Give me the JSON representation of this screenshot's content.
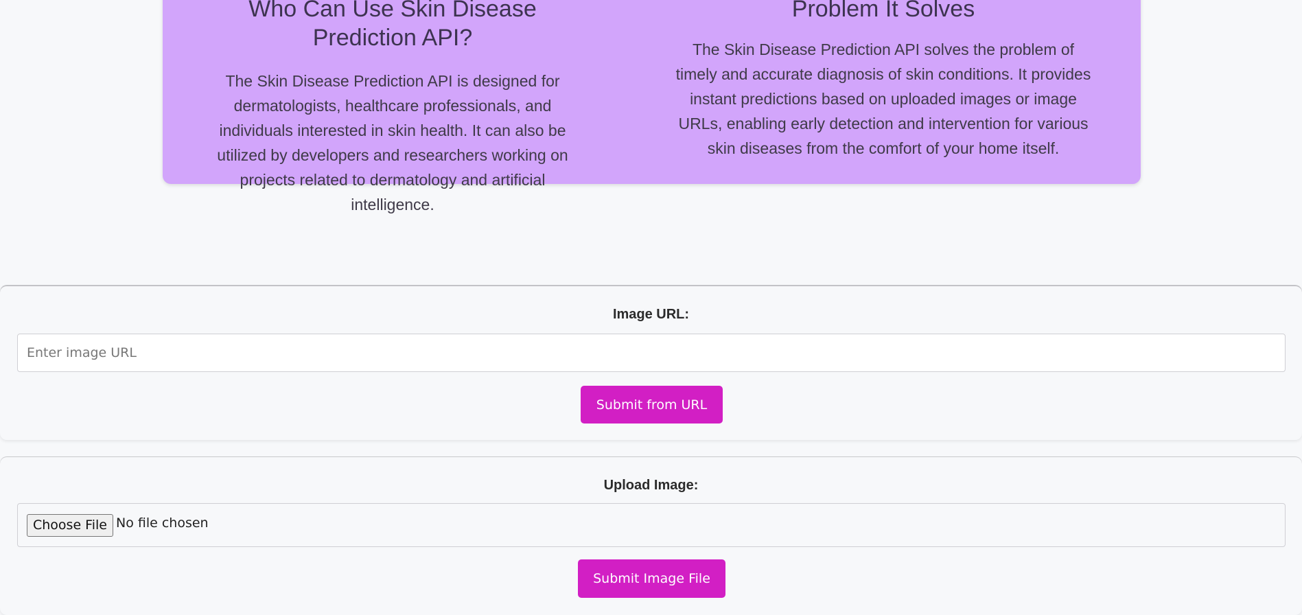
{
  "info": {
    "who": {
      "title": "Who Can Use Skin Disease Prediction API?",
      "body": "The Skin Disease Prediction API is designed for dermatologists, healthcare professionals, and individuals interested in skin health. It can also be utilized by developers and researchers working on projects related to dermatology and artificial intelligence."
    },
    "problem": {
      "title": "Problem It Solves",
      "body": "The Skin Disease Prediction API solves the problem of timely and accurate diagnosis of skin conditions. It provides instant predictions based on uploaded images or image URLs, enabling early detection and intervention for various skin diseases from the comfort of your home itself."
    },
    "card_color": "#d2a5fb"
  },
  "url_form": {
    "label": "Image URL:",
    "value": "",
    "placeholder": "Enter image URL",
    "submit_label": "Submit from URL"
  },
  "file_form": {
    "label": "Upload Image:",
    "choose_label": "Choose File",
    "status": "No file chosen",
    "submit_label": "Submit Image File"
  },
  "colors": {
    "accent": "#d21fc4",
    "background": "#f7f8fa"
  }
}
